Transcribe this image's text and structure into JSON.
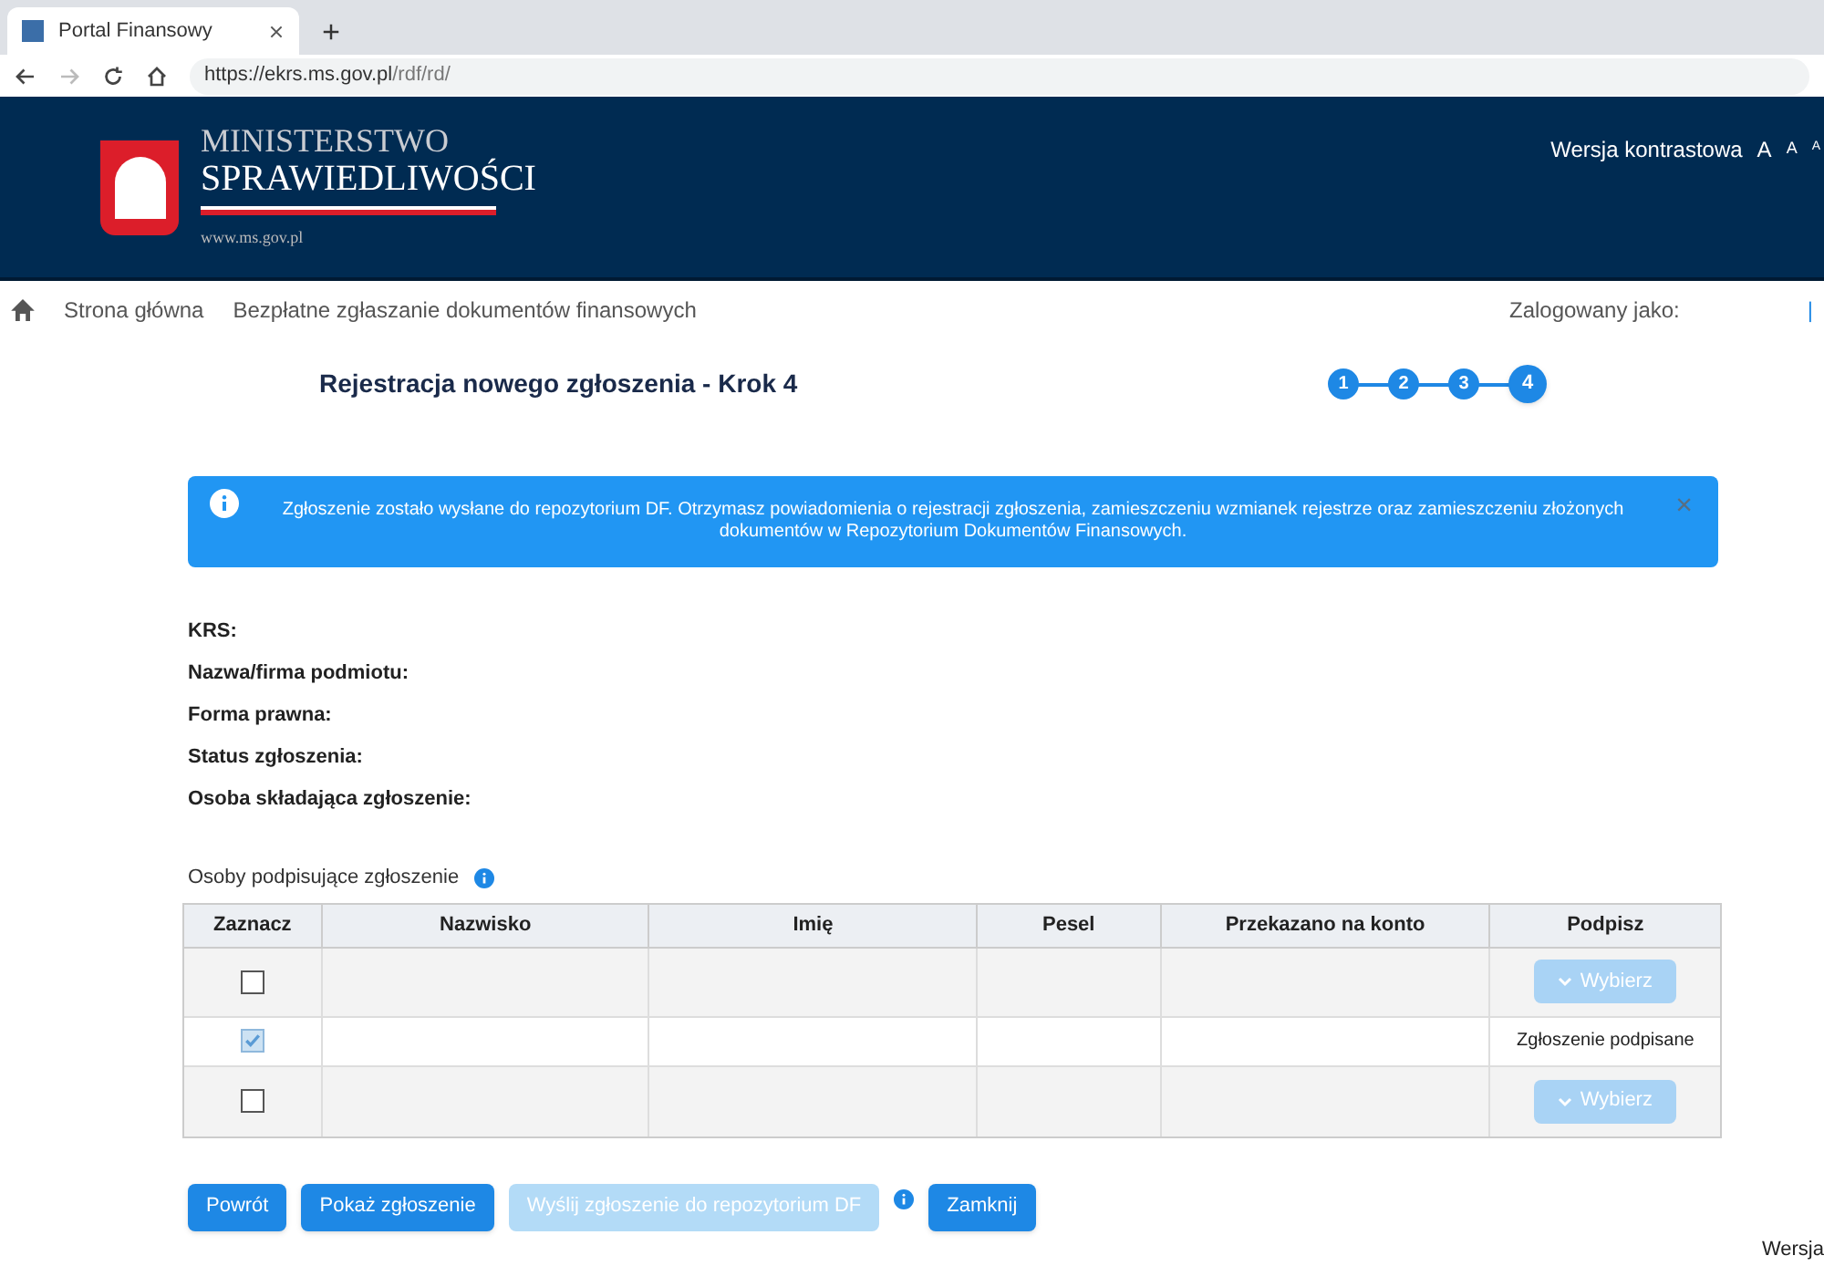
{
  "browser": {
    "tab_title": "Portal Finansowy",
    "url_host": "https://ekrs.ms.gov.pl",
    "url_path": "/rdf/rd/"
  },
  "header": {
    "logo_line1": "MINISTERSTWO",
    "logo_line2": "SPRAWIEDLIWOŚCI",
    "logo_url": "www.ms.gov.pl",
    "contrast": "Wersja kontrastowa",
    "font_sizes": [
      "A",
      "A",
      "A"
    ]
  },
  "nav": {
    "items": [
      "Strona główna",
      "Bezpłatne zgłaszanie dokumentów finansowych"
    ],
    "logged_as": "Zalogowany jako:",
    "cut_link": "|"
  },
  "page": {
    "title": "Rejestracja nowego zgłoszenia - Krok 4",
    "steps": [
      {
        "label": "1",
        "selected": false
      },
      {
        "label": "2",
        "selected": false
      },
      {
        "label": "3",
        "selected": false
      },
      {
        "label": "4",
        "selected": true
      }
    ]
  },
  "alert": {
    "text": "Zgłoszenie zostało wysłane do repozytorium DF. Otrzymasz powiadomienia o rejestracji zgłoszenia, zamieszczeniu wzmianek rejestrze oraz zamieszczeniu złożonych dokumentów w Repozytorium Dokumentów Finansowych.",
    "close": "×"
  },
  "fields": [
    "KRS:",
    "Nazwa/firma podmiotu:",
    "Forma prawna:",
    "Status zgłoszenia:",
    "Osoba składająca zgłoszenie:"
  ],
  "signers": {
    "title": "Osoby podpisujące zgłoszenie",
    "columns": [
      "Zaznacz",
      "Nazwisko",
      "Imię",
      "Pesel",
      "Przekazano na konto",
      "Podpisz"
    ],
    "rows": [
      {
        "kind": "button",
        "checked": false,
        "disabled": false,
        "action": "Wybierz"
      },
      {
        "kind": "signed",
        "checked": true,
        "disabled": true,
        "action": "Zgłoszenie podpisane"
      },
      {
        "kind": "button",
        "checked": false,
        "disabled": false,
        "action": "Wybierz"
      }
    ]
  },
  "buttons": [
    {
      "label": "Powrót",
      "disabled": false,
      "info": false
    },
    {
      "label": "Pokaż zgłoszenie",
      "disabled": false,
      "info": false
    },
    {
      "label": "Wyślij zgłoszenie do repozytorium DF",
      "disabled": true,
      "info": true
    },
    {
      "label": "Zamknij",
      "disabled": false,
      "info": false
    }
  ],
  "footer_cut": "Wersja"
}
